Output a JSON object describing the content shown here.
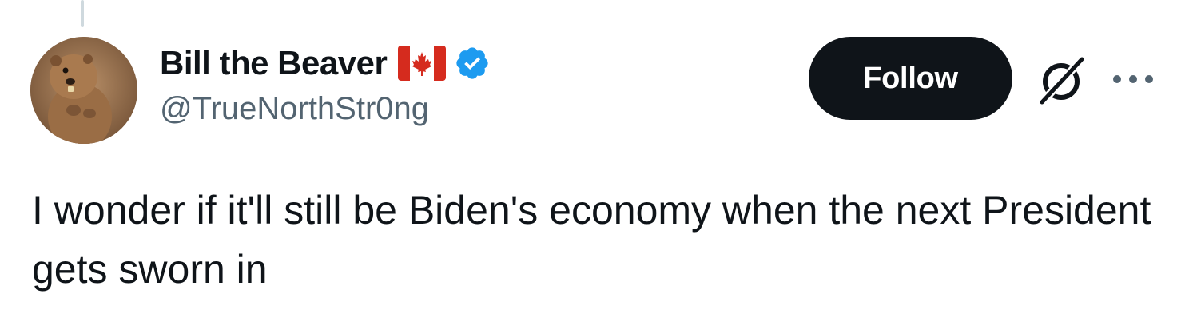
{
  "tweet": {
    "author": {
      "display_name": "Bill the Beaver",
      "handle": "@TrueNorthStr0ng",
      "flag_icon": "canada-flag-icon",
      "verified_icon": "verified-badge-icon",
      "verified_color": "#1d9bf0",
      "avatar_icon": "beaver-avatar"
    },
    "actions": {
      "follow_label": "Follow",
      "grok_icon": "grok-icon",
      "more_icon": "more-options-icon"
    },
    "text": "I wonder if it'll still be Biden's economy when the next President gets sworn in"
  },
  "colors": {
    "text_primary": "#0f1419",
    "text_secondary": "#536471",
    "follow_bg": "#0f1419",
    "flag_red": "#d52b1e",
    "thread_line": "#cfd9de"
  }
}
